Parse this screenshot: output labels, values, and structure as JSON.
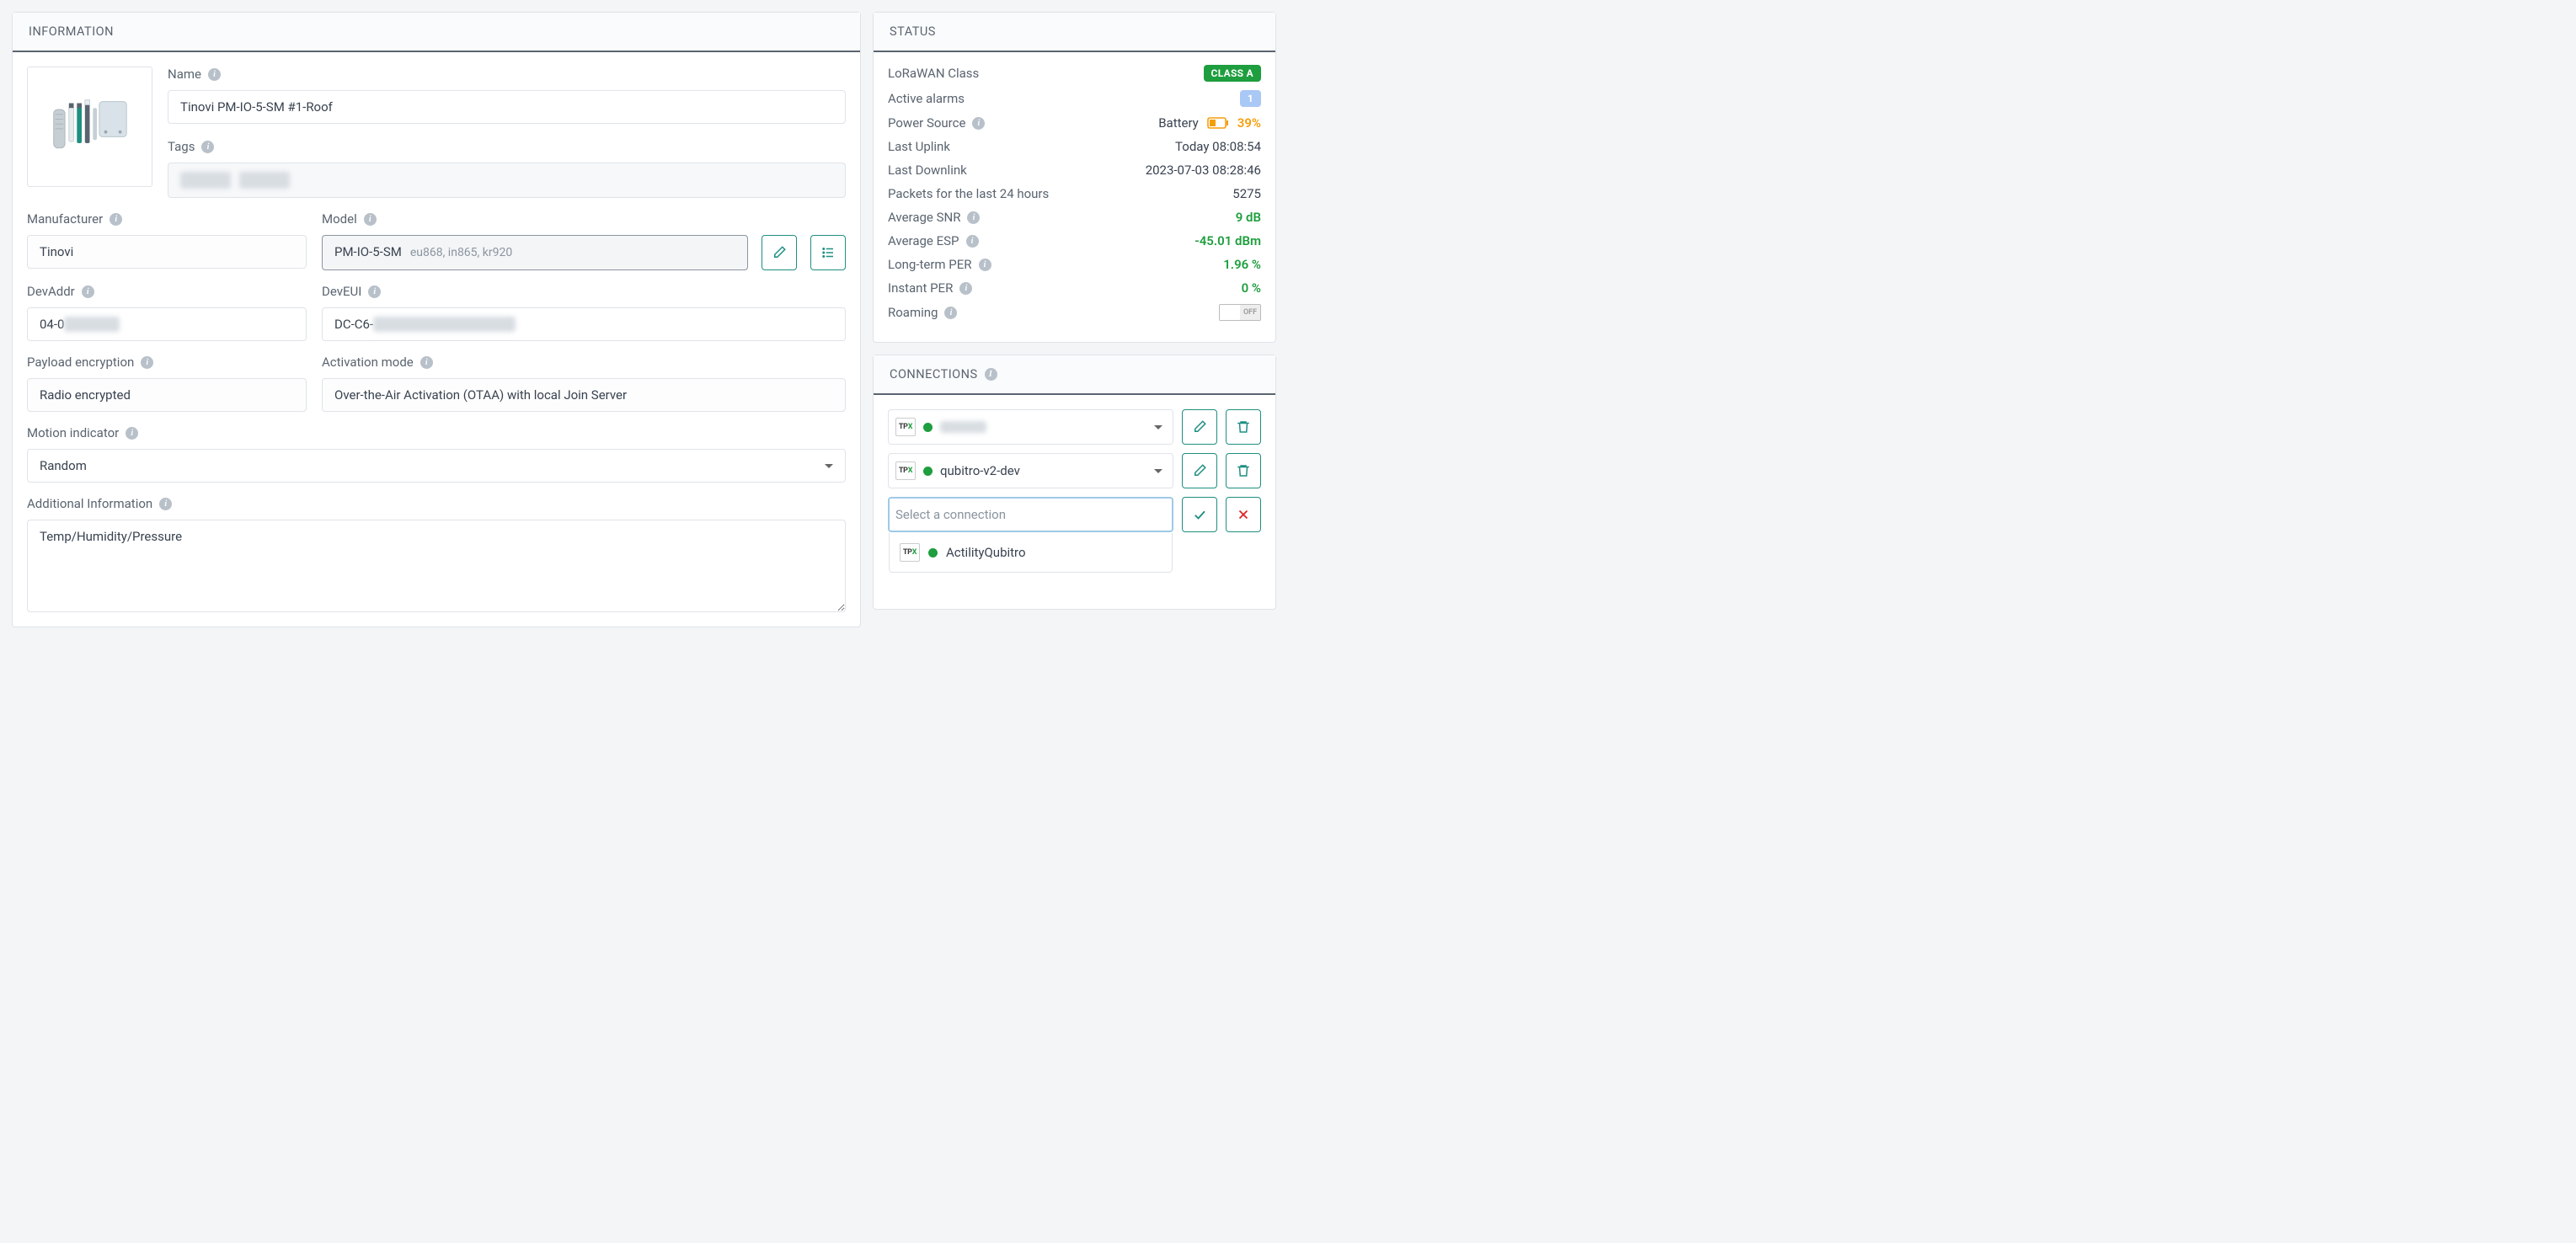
{
  "info": {
    "title": "INFORMATION",
    "name_label": "Name",
    "name_value": "Tinovi PM-IO-5-SM #1-Roof",
    "tags_label": "Tags",
    "manufacturer_label": "Manufacturer",
    "manufacturer_value": "Tinovi",
    "model_label": "Model",
    "model_value": "PM-IO-5-SM",
    "model_sub": "eu868, in865, kr920",
    "devaddr_label": "DevAddr",
    "devaddr_prefix": "04-0",
    "deveui_label": "DevEUI",
    "deveui_prefix": "DC-C6-",
    "payload_enc_label": "Payload encryption",
    "payload_enc_value": "Radio encrypted",
    "activation_label": "Activation mode",
    "activation_value": "Over-the-Air Activation (OTAA) with local Join Server",
    "motion_label": "Motion indicator",
    "motion_value": "Random",
    "additional_label": "Additional Information",
    "additional_value": "Temp/Humidity/Pressure"
  },
  "status": {
    "title": "STATUS",
    "rows": {
      "class_k": "LoRaWAN Class",
      "class_v": "CLASS A",
      "alarms_k": "Active alarms",
      "alarms_v": "1",
      "power_k": "Power Source",
      "power_v": "Battery",
      "power_pct": "39%",
      "uplink_k": "Last Uplink",
      "uplink_v": "Today 08:08:54",
      "downlink_k": "Last Downlink",
      "downlink_v": "2023-07-03 08:28:46",
      "packets_k": "Packets for the last 24 hours",
      "packets_v": "5275",
      "snr_k": "Average SNR",
      "snr_v": "9 dB",
      "esp_k": "Average ESP",
      "esp_v": "-45.01 dBm",
      "lper_k": "Long-term PER",
      "lper_v": "1.96 %",
      "iper_k": "Instant PER",
      "iper_v": "0 %",
      "roaming_k": "Roaming",
      "roaming_off": "OFF"
    }
  },
  "connections": {
    "title": "CONNECTIONS",
    "item2": "qubitro-v2-dev",
    "placeholder": "Select a connection",
    "option1": "ActilityQubitro"
  }
}
